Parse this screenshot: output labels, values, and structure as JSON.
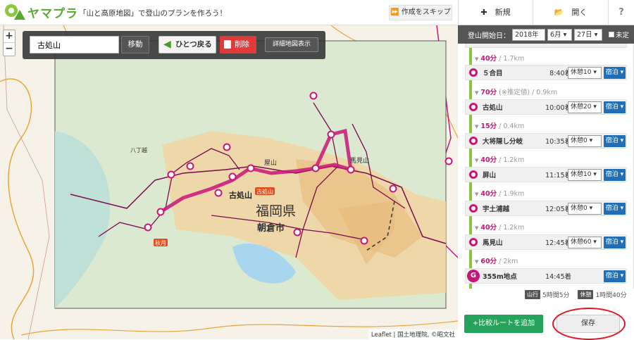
{
  "header": {
    "logo": "ヤマプラ",
    "tagline": "「山と高原地図」で登山のプランを作ろう！",
    "skip_label": "作成をスキップ"
  },
  "tabs": {
    "new_label": "新規",
    "open_label": "開く",
    "help_label": "?"
  },
  "map": {
    "zoom_in": "+",
    "zoom_out": "−",
    "search_value": "古処山",
    "move_label": "移動",
    "undo_label": "ひとつ戻る",
    "delete_label": "削除",
    "detail_label": "詳細地図表示",
    "attribution": "Leaflet | 国土地理院, ©昭文社",
    "labels": {
      "summit": "古処山",
      "prefecture": "福岡県",
      "city": "朝倉市",
      "tag_kosho": "古処山",
      "tag_akizuki": "秋月",
      "yamami": "馬見山",
      "yashiro": "屋山",
      "hachiya": "八丁越"
    }
  },
  "panel": {
    "start_label": "登山開始日：",
    "year": "2018年",
    "month": "6月",
    "day": "27日",
    "undecided": "未定",
    "stops": [
      {
        "name": "５合目",
        "time": "8:40着",
        "rest": "休憩10",
        "lodging": "宿泊"
      },
      {
        "name": "古処山",
        "time": "10:00着",
        "rest": "休憩20",
        "lodging": "宿泊"
      },
      {
        "name": "大将隠し分岐",
        "time": "10:35着",
        "rest": "休憩0",
        "lodging": "宿泊"
      },
      {
        "name": "屏山",
        "time": "11:15着",
        "rest": "休憩10",
        "lodging": "宿泊"
      },
      {
        "name": "宇土浦越",
        "time": "12:05着",
        "rest": "休憩0",
        "lodging": "宿泊"
      },
      {
        "name": "馬見山",
        "time": "12:45着",
        "rest": "休憩60",
        "lodging": "宿泊"
      },
      {
        "name": "355m地点",
        "time": "14:45着",
        "rest": "",
        "lodging": "宿泊",
        "goal": "G"
      }
    ],
    "segments": [
      {
        "mins": "40分",
        "dist": " / 1.7km"
      },
      {
        "mins": "70分",
        "note": " (※推定値)",
        "dist": " / 0.9km"
      },
      {
        "mins": "15分",
        "dist": " / 0.4km"
      },
      {
        "mins": "40分",
        "dist": " / 1.2km"
      },
      {
        "mins": "40分",
        "dist": " / 1.9km"
      },
      {
        "mins": "40分",
        "dist": " / 1.2km"
      },
      {
        "mins": "60分",
        "dist": " / 2km"
      }
    ],
    "totals": {
      "climb_badge": "山行",
      "climb": "5時間5分",
      "rest_badge": "休憩",
      "rest": "1時間40分"
    },
    "add_compare_label": "+比較ルートを追加",
    "save_label": "保存"
  },
  "colors": {
    "route": "#c8157a",
    "accent_green": "#8cc63f",
    "lodging_blue": "#1f6fb8",
    "save_highlight": "#e8111e"
  }
}
